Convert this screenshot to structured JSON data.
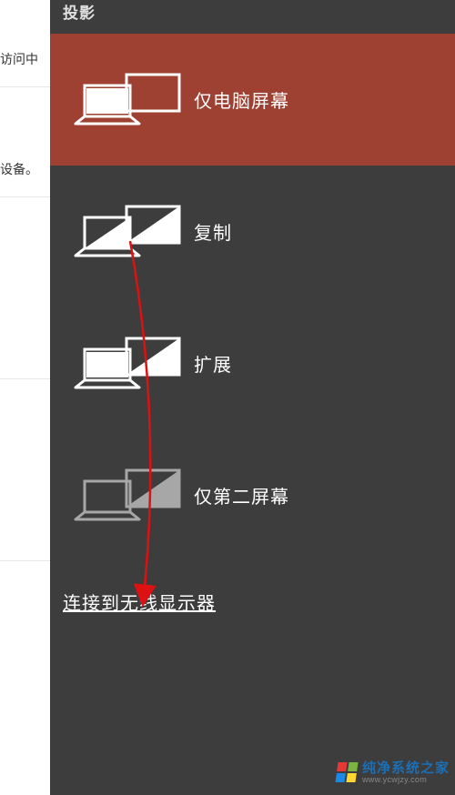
{
  "background": {
    "row1_partial": "访问中",
    "row2_partial": "设备。"
  },
  "panel": {
    "title": "投影",
    "options": [
      {
        "id": "pc-only",
        "label": "仅电脑屏幕",
        "selected": true
      },
      {
        "id": "duplicate",
        "label": "复制",
        "selected": false
      },
      {
        "id": "extend",
        "label": "扩展",
        "selected": false
      },
      {
        "id": "second-only",
        "label": "仅第二屏幕",
        "selected": false
      }
    ],
    "wireless_link": "连接到无线显示器"
  },
  "watermark": {
    "main": "纯净系统之家",
    "sub": "www.ycwjzy.com",
    "colors": [
      "#e53935",
      "#7cb342",
      "#1e88e5",
      "#fdd835"
    ]
  }
}
